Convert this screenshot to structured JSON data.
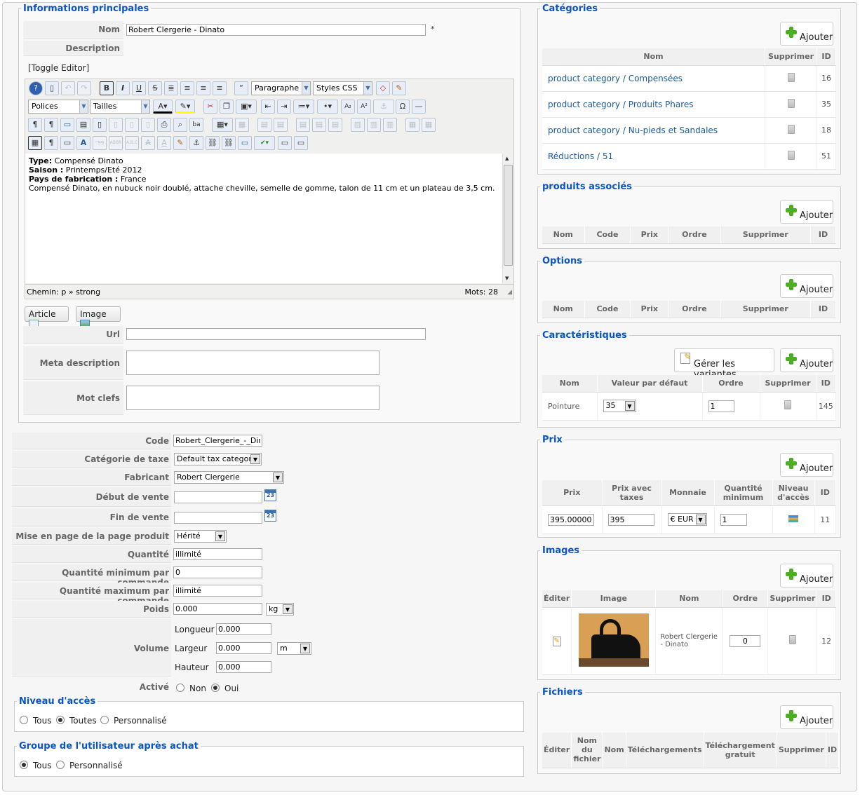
{
  "main": {
    "legend": "Informations principales",
    "nom_label": "Nom",
    "nom_value": "Robert Clergerie - Dinato",
    "required": "*",
    "description_label": "Description",
    "toggle_editor": "[Toggle Editor]",
    "editor": {
      "format_select": "Paragraphe",
      "styles_select": "Styles CSS",
      "font_select": "Polices",
      "size_select": "Tailles",
      "content": {
        "line1_bold": "Type:",
        "line1": " Compensé Dinato",
        "line2_bold": "Saison :",
        "line2": " Printemps/Eté 2012",
        "line3_bold": "Pays de fabrication :",
        "line3": " France",
        "line4": "Compensé Dinato, en nubuck noir doublé, attache cheville, semelle de gomme, talon de 11 cm et un plateau de 3,5 cm."
      },
      "path": "Chemin: p » strong",
      "words": "Mots: 28"
    },
    "article_btn": "Article",
    "image_btn": "Image",
    "url_label": "Url",
    "meta_label": "Meta description",
    "keywords_label": "Mot clefs"
  },
  "details": {
    "code_label": "Code",
    "code_value": "Robert_Clergerie_-_Dinato",
    "tax_label": "Catégorie de taxe",
    "tax_value": "Default tax category",
    "maker_label": "Fabricant",
    "maker_value": "Robert Clergerie",
    "start_label": "Début de vente",
    "end_label": "Fin de vente",
    "cal_text": "23",
    "layout_label": "Mise en page de la page produit",
    "layout_value": "Hérité",
    "qty_label": "Quantité",
    "qty_value": "illimité",
    "qmin_label": "Quantité minimum par commande",
    "qmin_value": "0",
    "qmax_label": "Quantité maximum par commande",
    "qmax_value": "illimité",
    "weight_label": "Poids",
    "weight_value": "0.000",
    "weight_unit": "kg",
    "volume_label": "Volume",
    "length_label": "Longueur",
    "length_value": "0.000",
    "width_label": "Largeur",
    "width_value": "0.000",
    "height_label": "Hauteur",
    "height_value": "0.000",
    "vol_unit": "m",
    "active_label": "Activé",
    "active_no": "Non",
    "active_yes": "Oui"
  },
  "access": {
    "legend": "Niveau d'accès",
    "opt1": "Tous",
    "opt2": "Toutes",
    "opt3": "Personnalisé"
  },
  "group": {
    "legend": "Groupe de l'utilisateur après achat",
    "opt1": "Tous",
    "opt2": "Personnalisé"
  },
  "add_label": "Ajouter",
  "categories": {
    "legend": "Catégories",
    "headers": [
      "Nom",
      "Supprimer",
      "ID"
    ],
    "rows": [
      {
        "prefix": "product category / ",
        "name": "Compensées",
        "id": "16"
      },
      {
        "prefix": "product category / ",
        "name": "Produits Phares",
        "id": "35"
      },
      {
        "prefix": "product category / ",
        "name": "Nu-pieds et Sandales",
        "id": "18"
      },
      {
        "prefix": "Réductions / ",
        "name": "51",
        "id": "51"
      }
    ]
  },
  "related": {
    "legend": "produits associés",
    "headers": [
      "Nom",
      "Code",
      "Prix",
      "Ordre",
      "Supprimer",
      "ID"
    ]
  },
  "options": {
    "legend": "Options",
    "headers": [
      "Nom",
      "Code",
      "Prix",
      "Ordre",
      "Supprimer",
      "ID"
    ]
  },
  "characteristics": {
    "legend": "Caractéristiques",
    "manage_btn": "Gérer les variantes",
    "headers": [
      "Nom",
      "Valeur par défaut",
      "Ordre",
      "Supprimer",
      "ID"
    ],
    "row": {
      "name": "Pointure",
      "default": "35",
      "order": "1",
      "id": "145"
    }
  },
  "price": {
    "legend": "Prix",
    "headers": [
      "Prix",
      "Prix avec taxes",
      "Monnaie",
      "Quantité minimum",
      "Niveau d'accès",
      "ID"
    ],
    "row": {
      "price": "395.00000",
      "price_tax": "395",
      "currency": "€ EUR",
      "min_qty": "1",
      "id": "11"
    }
  },
  "images": {
    "legend": "Images",
    "headers": [
      "Éditer",
      "Image",
      "Nom",
      "Ordre",
      "Supprimer",
      "ID"
    ],
    "row": {
      "name": "Robert Clergerie - Dinato",
      "order": "0",
      "id": "12"
    }
  },
  "files": {
    "legend": "Fichiers",
    "headers": [
      "Éditer",
      "Nom du fichier",
      "Nom",
      "Téléchargements",
      "Téléchargement gratuit",
      "Supprimer",
      "ID"
    ]
  },
  "icons": [
    "help-icon",
    "new-document-icon",
    "undo-icon",
    "redo-icon",
    "bold-icon",
    "italic-icon",
    "underline-icon",
    "strikethrough-icon",
    "trash-icon",
    "calendar-icon",
    "add-icon",
    "edit-icon",
    "access-level-icon"
  ]
}
